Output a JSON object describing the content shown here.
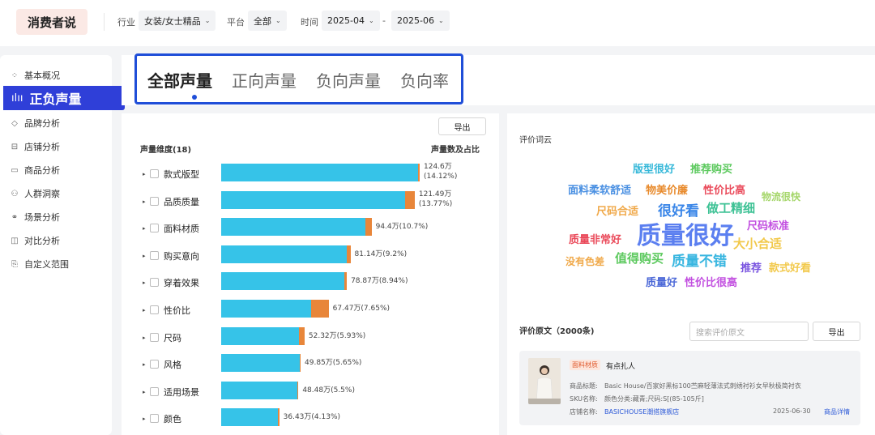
{
  "app": {
    "logo": "消费者说"
  },
  "filters": {
    "industry_label": "行业",
    "industry_value": "女装/女士精品",
    "platform_label": "平台",
    "platform_value": "全部",
    "time_label": "时间",
    "time_start": "2025-04",
    "time_sep": "-",
    "time_end": "2025-06"
  },
  "sidebar": {
    "items": [
      {
        "label": "基本概况",
        "icon": "grid-icon"
      },
      {
        "label": "正负声量",
        "icon": "voice-bars-icon",
        "active": true
      },
      {
        "label": "品牌分析",
        "icon": "tag-icon"
      },
      {
        "label": "店铺分析",
        "icon": "store-icon"
      },
      {
        "label": "商品分析",
        "icon": "box-icon"
      },
      {
        "label": "人群洞察",
        "icon": "people-icon"
      },
      {
        "label": "场景分析",
        "icon": "scene-icon"
      },
      {
        "label": "对比分析",
        "icon": "compare-icon"
      },
      {
        "label": "自定义范围",
        "icon": "custom-doc-icon"
      }
    ]
  },
  "tabs": [
    {
      "label": "全部声量",
      "active": true
    },
    {
      "label": "正向声量"
    },
    {
      "label": "负向声量"
    },
    {
      "label": "负向率"
    }
  ],
  "left_panel": {
    "export_label": "导出",
    "dimension_header": "声量维度(18)",
    "value_header": "声量数及占比"
  },
  "chart_data": {
    "type": "bar",
    "orientation": "horizontal",
    "stacked": true,
    "colors": {
      "positive": "#36c3e8",
      "negative": "#e8863a"
    },
    "categories": [
      "款式版型",
      "品质质量",
      "面料材质",
      "购买意向",
      "穿着效果",
      "性价比",
      "尺码",
      "风格",
      "适用场景",
      "颜色"
    ],
    "totals": [
      124.6,
      121.49,
      94.4,
      81.14,
      78.87,
      67.47,
      52.32,
      49.85,
      48.48,
      36.43
    ],
    "negative_share": [
      0.01,
      0.05,
      0.04,
      0.03,
      0.02,
      0.16,
      0.07,
      0.005,
      0.005,
      0.01
    ],
    "value_labels": [
      "124.6万(14.12%)",
      "121.49万(13.77%)",
      "94.4万(10.7%)",
      "81.14万(9.2%)",
      "78.87万(8.94%)",
      "67.47万(7.65%)",
      "52.32万(5.93%)",
      "49.85万(5.65%)",
      "48.48万(5.5%)",
      "36.43万(4.13%)"
    ],
    "max": 124.6
  },
  "right_panel": {
    "wordcloud_title": "评价词云",
    "words": [
      {
        "text": "版型很好",
        "color": "#36b8d9",
        "size": 13
      },
      {
        "text": "推荐购买",
        "color": "#5cc95e",
        "size": 13
      },
      {
        "text": "面料柔软舒适",
        "color": "#4a90e2",
        "size": 13
      },
      {
        "text": "物美价廉",
        "color": "#e88a2c",
        "size": 13
      },
      {
        "text": "性价比高",
        "color": "#ea4a5a",
        "size": 13
      },
      {
        "text": "物流很快",
        "color": "#a5d66a",
        "size": 12
      },
      {
        "text": "尺码合适",
        "color": "#f0a94a",
        "size": 13
      },
      {
        "text": "很好看",
        "color": "#3a86e8",
        "size": 17
      },
      {
        "text": "做工精细",
        "color": "#3ec295",
        "size": 15
      },
      {
        "text": "尺码标准",
        "color": "#c24fe0",
        "size": 13
      },
      {
        "text": "质量非常好",
        "color": "#ea4a5a",
        "size": 13
      },
      {
        "text": "质量很好",
        "color": "#5b7ff0",
        "size": 30
      },
      {
        "text": "大小合适",
        "color": "#f2c94c",
        "size": 15
      },
      {
        "text": "没有色差",
        "color": "#f0a94a",
        "size": 12
      },
      {
        "text": "值得购买",
        "color": "#5cc95e",
        "size": 15
      },
      {
        "text": "质量不错",
        "color": "#38b6e0",
        "size": 17
      },
      {
        "text": "推荐",
        "color": "#7a55e0",
        "size": 13
      },
      {
        "text": "款式好看",
        "color": "#f2c94c",
        "size": 13
      },
      {
        "text": "质量好",
        "color": "#4e6ad8",
        "size": 13
      },
      {
        "text": "性价比很高",
        "color": "#c24fe0",
        "size": 13
      }
    ],
    "reviews_title": "评价原文（2000条)",
    "search_placeholder": "搜索评价原文",
    "export_label": "导出",
    "review": {
      "tag": "面料材质",
      "text": "有点扎人",
      "product_label": "商品标题:",
      "product_value": "Basic House/百家好黑标100苎麻轻薄法式刺绣衬衫女早秋极简衬衣",
      "sku_label": "SKU名称:",
      "sku_value": "颜色分类:藏青;尺码:S[(85-105斤]",
      "store_label": "店铺名称:",
      "store_value": "BASICHOUSE潮搭旗舰店",
      "date": "2025-06-30",
      "detail_link": "商品详情"
    }
  }
}
